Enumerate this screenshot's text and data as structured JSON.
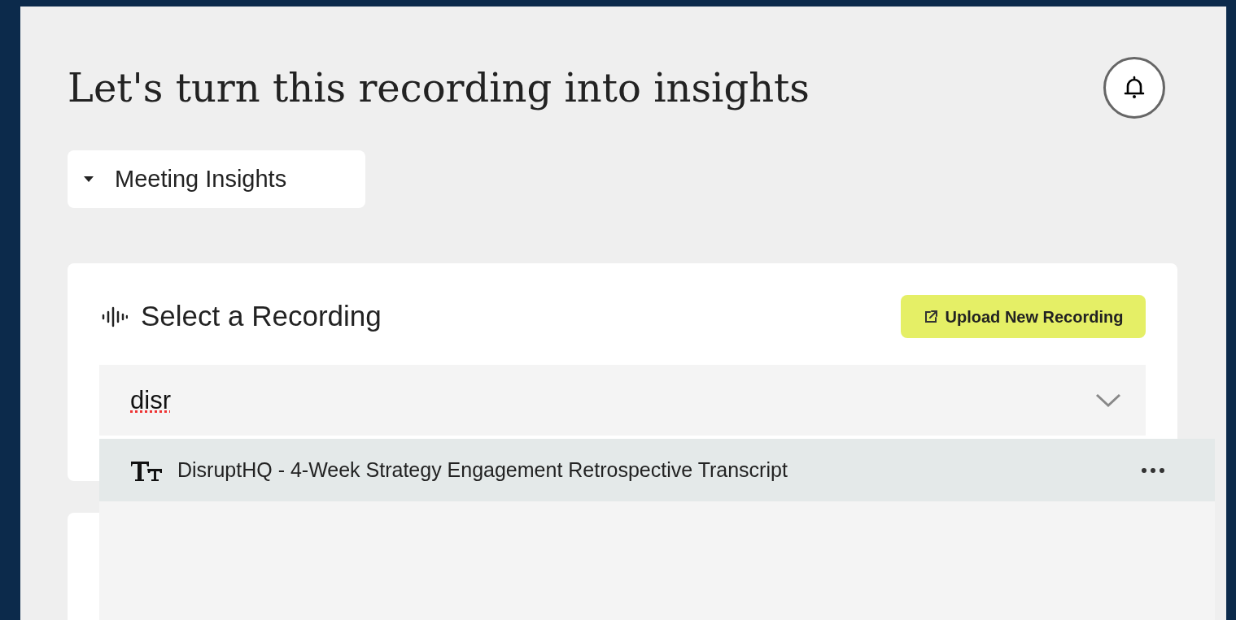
{
  "page": {
    "title": "Let's turn this recording into insights"
  },
  "template_dropdown": {
    "label": "Meeting Insights",
    "expanded": false
  },
  "recording_card": {
    "title": "Select a Recording",
    "upload_button": "Upload New Recording",
    "search": {
      "value": "disr"
    },
    "options": [
      {
        "label": "DisruptHQ - 4-Week Strategy Engagement Retrospective Transcript",
        "selected": true
      }
    ]
  }
}
